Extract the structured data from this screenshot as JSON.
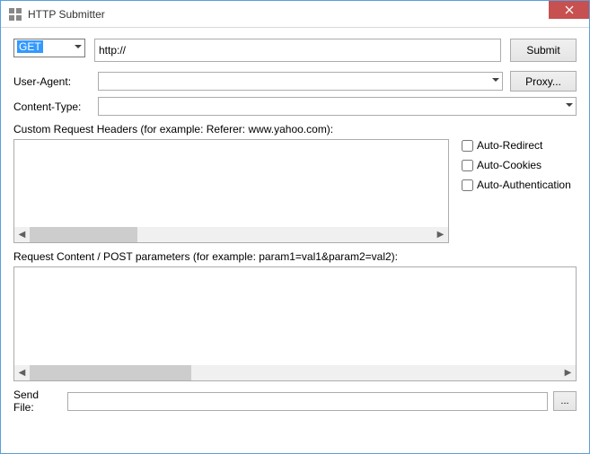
{
  "window": {
    "title": "HTTP Submitter"
  },
  "method": {
    "selected": "GET"
  },
  "url": {
    "value": "http://"
  },
  "buttons": {
    "submit": "Submit",
    "proxy": "Proxy...",
    "browse": "..."
  },
  "labels": {
    "userAgent": "User-Agent:",
    "contentType": "Content-Type:",
    "customHeaders": "Custom Request Headers (for example: Referer: www.yahoo.com):",
    "requestContent": "Request Content / POST parameters (for example: param1=val1&param2=val2):",
    "sendFile": "Send File:"
  },
  "userAgent": {
    "value": ""
  },
  "contentType": {
    "value": ""
  },
  "customHeaders": {
    "value": ""
  },
  "requestContent": {
    "value": ""
  },
  "sendFile": {
    "value": ""
  },
  "checks": {
    "autoRedirect": "Auto-Redirect",
    "autoCookies": "Auto-Cookies",
    "autoAuth": "Auto-Authentication"
  }
}
